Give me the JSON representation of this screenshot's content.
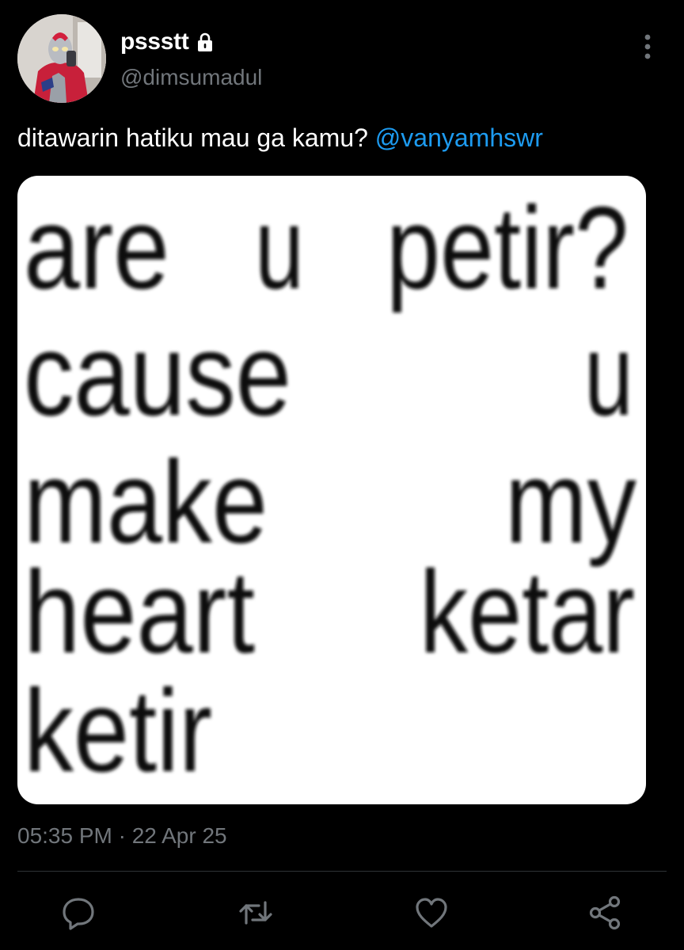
{
  "tweet": {
    "display_name": "pssstt",
    "handle": "@dimsumadul",
    "text": "ditawarin hatiku mau ga kamu? ",
    "mention": "@vanyamhswr",
    "timestamp": "05:35 PM · 22 Apr 25"
  },
  "media": {
    "lines": [
      [
        "are",
        "u",
        "petir?"
      ],
      [
        "cause",
        "u"
      ],
      [
        "make",
        "my"
      ],
      [
        "heart",
        "ketar"
      ],
      [
        "ketir"
      ]
    ]
  },
  "icons": {
    "lock": "lock-icon",
    "more": "more-vertical-icon",
    "reply": "reply-icon",
    "retweet": "retweet-icon",
    "like": "heart-icon",
    "share": "share-icon"
  },
  "colors": {
    "background": "#000000",
    "text": "#ffffff",
    "secondary": "#71767b",
    "mention": "#1d9bf0",
    "divider": "#2f3336"
  }
}
